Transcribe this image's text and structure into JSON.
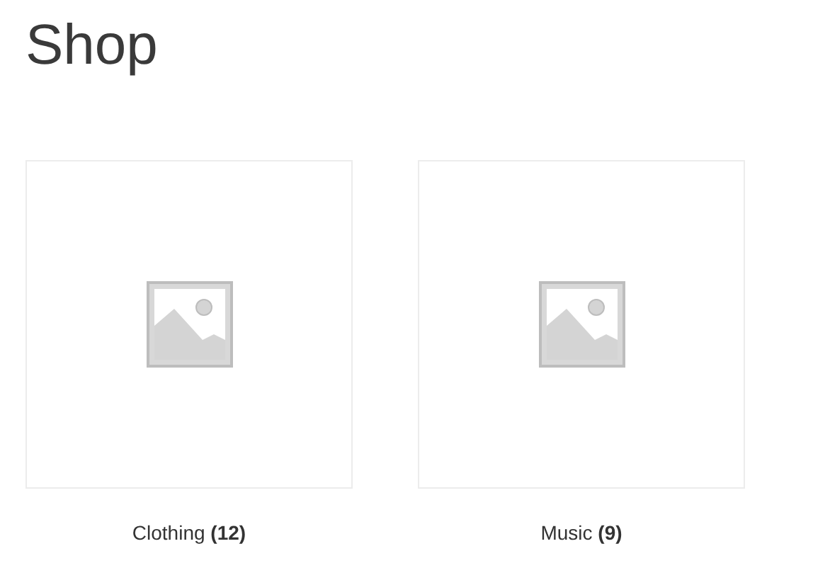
{
  "page_title": "Shop",
  "categories": [
    {
      "image": {
        "kind": "placeholder"
      },
      "label": "Clothing **(12)**"
    },
    {
      "image": {
        "kind": "placeholder"
      },
      "label": "Music **(9)**"
    }
  ]
}
